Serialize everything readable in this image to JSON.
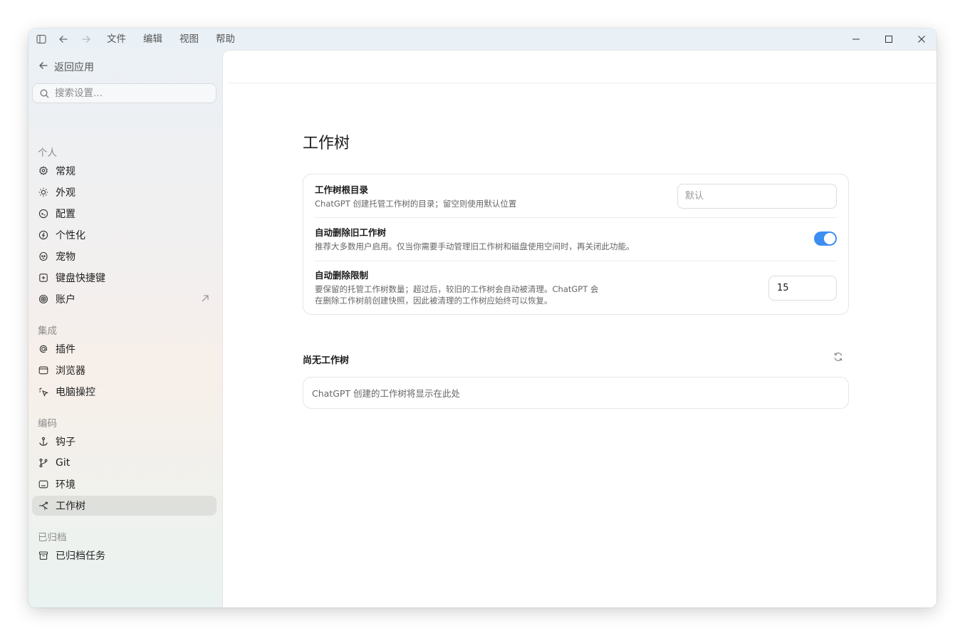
{
  "titlebar": {
    "menu": [
      "文件",
      "编辑",
      "视图",
      "帮助"
    ]
  },
  "sidebar": {
    "back_label": "返回应用",
    "search_placeholder": "搜索设置...",
    "sections": {
      "personal": "个人",
      "integrations": "集成",
      "coding": "编码",
      "archived": "已归档"
    },
    "items": {
      "general": "常规",
      "appearance": "外观",
      "config": "配置",
      "personalization": "个性化",
      "pets": "宠物",
      "shortcuts": "键盘快捷键",
      "account": "账户",
      "plugins": "插件",
      "browser": "浏览器",
      "computer_use": "电脑操控",
      "hooks": "钩子",
      "git": "Git",
      "environment": "环境",
      "worktrees": "工作树",
      "archived_tasks": "已归档任务"
    },
    "active_item": "worktrees"
  },
  "main": {
    "title": "工作树",
    "settings": {
      "root": {
        "title": "工作树根目录",
        "desc": "ChatGPT 创建托管工作树的目录；留空则使用默认位置",
        "placeholder": "默认"
      },
      "auto_delete": {
        "title": "自动删除旧工作树",
        "desc": "推荐大多数用户启用。仅当你需要手动管理旧工作树和磁盘使用空间时，再关闭此功能。",
        "enabled": true
      },
      "limit": {
        "title": "自动删除限制",
        "desc_line1": "要保留的托管工作树数量；超过后，较旧的工作树会自动被清理。ChatGPT 会",
        "desc_line2": "在删除工作树前创建快照，因此被清理的工作树应始终可以恢复。",
        "value": "15"
      }
    },
    "worktrees_section": {
      "title": "尚无工作树",
      "empty_text": "ChatGPT 创建的工作树将显示在此处"
    }
  },
  "colors": {
    "accent": "#3d8ef2"
  }
}
